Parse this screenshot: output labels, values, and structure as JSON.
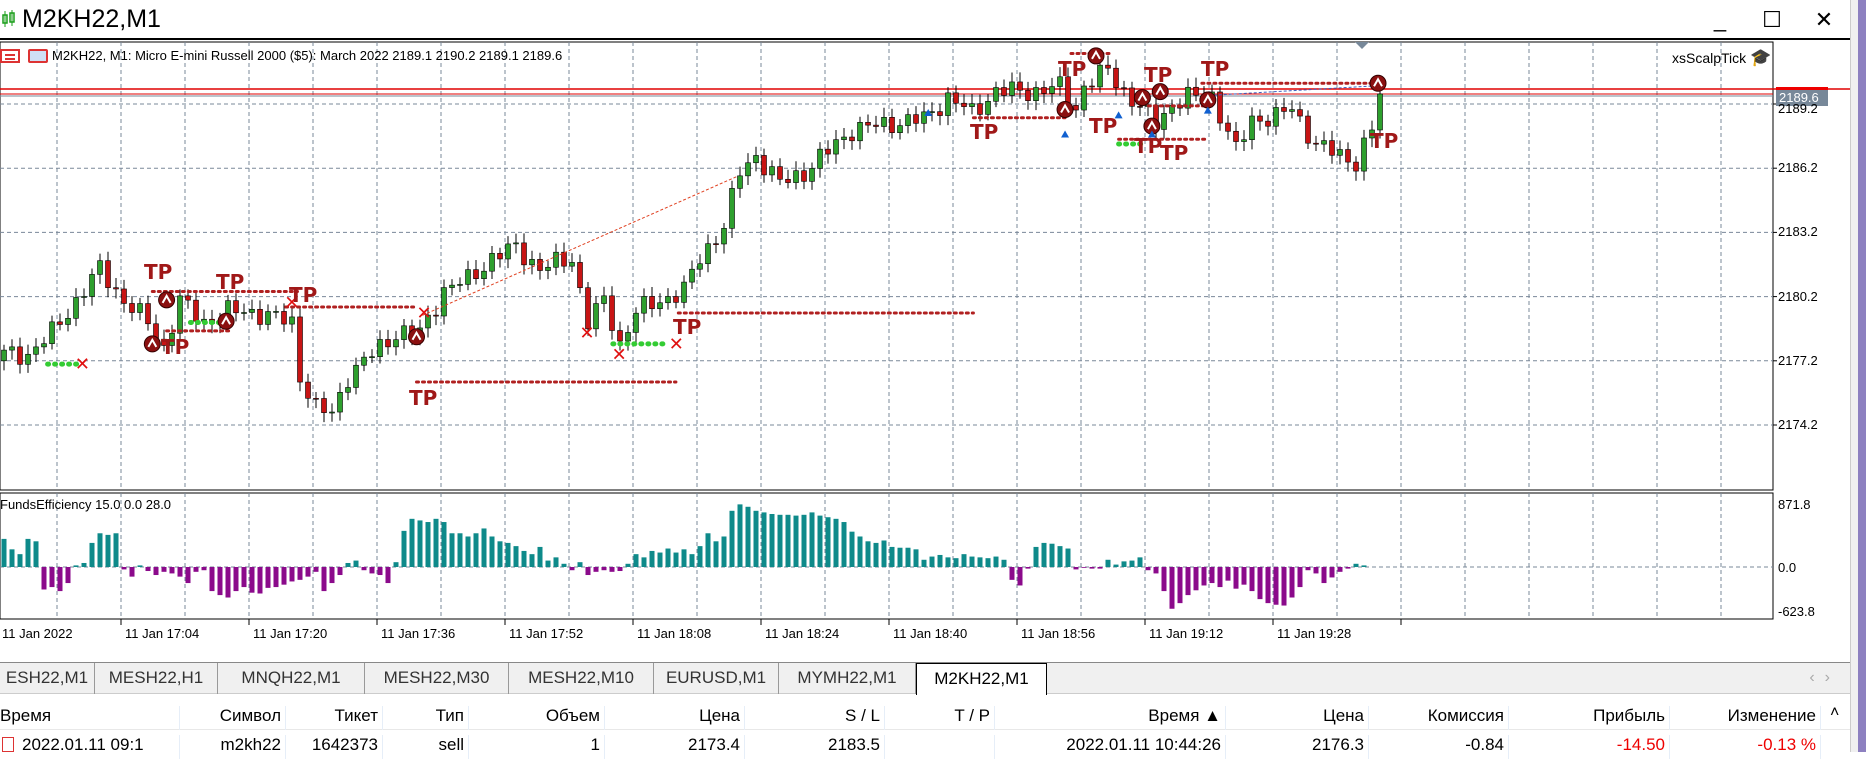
{
  "window": {
    "title": "M2KH22,M1",
    "minimize": "_",
    "maximize": "☐",
    "close": "✕"
  },
  "chart": {
    "info": "M2KH22, M1:  Micro E-mini Russell 2000 ($5): March 2022  2189.1 2190.2 2189.1 2189.6",
    "expert": "xsScalpTick",
    "current_price": "2189.6",
    "price_labels": [
      "2189.2",
      "2186.2",
      "2183.2",
      "2180.2",
      "2177.2",
      "2174.2"
    ],
    "time_labels": [
      "11 Jan 2022",
      "11 Jan 17:04",
      "11 Jan 17:20",
      "11 Jan 17:36",
      "11 Jan 17:52",
      "11 Jan 18:08",
      "11 Jan 18:24",
      "11 Jan 18:40",
      "11 Jan 18:56",
      "11 Jan 19:12",
      "11 Jan 19:28"
    ],
    "tp_label": "TP",
    "colors": {
      "bull": "#2ea02e",
      "bear": "#c81414",
      "indicator_pos": "#0e8a8a",
      "indicator_neg": "#8b0a8b",
      "price_line": "#e00000",
      "price_box": "#778899"
    }
  },
  "indicator": {
    "title": "FundsEfficiency 15.0 0.0 28.0",
    "max_label": "871.8",
    "zero_label": "0.0",
    "min_label": "-623.8"
  },
  "chart_data": {
    "type": "candlestick",
    "start_time": "16:49",
    "timeframe": "M1",
    "price_keypoints": [
      [
        "16:49",
        2177.5
      ],
      [
        "16:52",
        2177.5
      ],
      [
        "16:55",
        2178.5
      ],
      [
        "16:58",
        2180
      ],
      [
        "17:01",
        2181.5
      ],
      [
        "17:04",
        2180
      ],
      [
        "17:07",
        2179
      ],
      [
        "17:09",
        2177.8
      ],
      [
        "17:11",
        2180
      ],
      [
        "17:14",
        2179
      ],
      [
        "17:17",
        2179.5
      ],
      [
        "17:20",
        2179.5
      ],
      [
        "17:25",
        2179
      ],
      [
        "17:26",
        2176.5
      ],
      [
        "17:28",
        2175
      ],
      [
        "17:30",
        2174.7
      ],
      [
        "17:32",
        2176.5
      ],
      [
        "17:35",
        2177.5
      ],
      [
        "17:38",
        2178.5
      ],
      [
        "17:41",
        2178.5
      ],
      [
        "17:44",
        2180.5
      ],
      [
        "17:47",
        2181
      ],
      [
        "17:50",
        2182
      ],
      [
        "17:53",
        2182.5
      ],
      [
        "17:56",
        2181.5
      ],
      [
        "18:00",
        2182
      ],
      [
        "18:02",
        2179
      ],
      [
        "18:04",
        2180
      ],
      [
        "18:06",
        2178
      ],
      [
        "18:08",
        2179.5
      ],
      [
        "18:11",
        2180
      ],
      [
        "18:14",
        2180.5
      ],
      [
        "18:16",
        2182
      ],
      [
        "18:19",
        2183.5
      ],
      [
        "18:21",
        2186
      ],
      [
        "18:23",
        2186.8
      ],
      [
        "18:26",
        2185.5
      ],
      [
        "18:29",
        2186
      ],
      [
        "18:32",
        2187
      ],
      [
        "18:35",
        2188
      ],
      [
        "18:40",
        2188.3
      ],
      [
        "18:44",
        2188.5
      ],
      [
        "18:47",
        2189.5
      ],
      [
        "18:50",
        2188.8
      ],
      [
        "18:53",
        2189.8
      ],
      [
        "18:58",
        2189.8
      ],
      [
        "19:01",
        2190
      ],
      [
        "19:03",
        2189
      ],
      [
        "19:04",
        2190
      ],
      [
        "19:07",
        2190.8
      ],
      [
        "19:09",
        2189.8
      ],
      [
        "19:11",
        2189
      ],
      [
        "19:13",
        2188.3
      ],
      [
        "19:15",
        2189.2
      ],
      [
        "19:17",
        2189.5
      ],
      [
        "19:20",
        2189.6
      ],
      [
        "19:23",
        2187
      ],
      [
        "19:25",
        2188.5
      ],
      [
        "19:28",
        2188.6
      ],
      [
        "19:30",
        2189
      ],
      [
        "19:33",
        2187.3
      ],
      [
        "19:36",
        2186.8
      ],
      [
        "19:38",
        2186.5
      ],
      [
        "19:40",
        2188
      ],
      [
        "19:41",
        2189.6
      ]
    ],
    "ylim": [
      2173.0,
      2191.0
    ],
    "indicator_values": [
      350,
      220,
      160,
      350,
      320,
      -280,
      -250,
      -300,
      -200,
      20,
      50,
      300,
      420,
      400,
      420,
      -30,
      -120,
      20,
      -50,
      -100,
      -60,
      -80,
      -120,
      -200,
      -60,
      -40,
      -300,
      -350,
      -380,
      -300,
      -250,
      -320,
      -330,
      -260,
      -250,
      -220,
      -180,
      -160,
      -120,
      -60,
      -300,
      -200,
      -100,
      50,
      80,
      -40,
      -80,
      -100,
      -200,
      60,
      450,
      600,
      580,
      560,
      600,
      560,
      420,
      420,
      380,
      420,
      480,
      380,
      320,
      300,
      260,
      200,
      160,
      250,
      80,
      120,
      40,
      -40,
      60,
      -100,
      -60,
      -40,
      -60,
      -50,
      40,
      160,
      120,
      200,
      180,
      230,
      180,
      220,
      160,
      260,
      420,
      320,
      380,
      700,
      780,
      750,
      700,
      680,
      660,
      650,
      650,
      640,
      650,
      680,
      640,
      620,
      600,
      560,
      440,
      380,
      320,
      300,
      330,
      250,
      240,
      240,
      220,
      90,
      130,
      150,
      120,
      110,
      160,
      130,
      120,
      110,
      130,
      90,
      -160,
      -230,
      -20,
      250,
      300,
      290,
      260,
      230,
      -30,
      -10,
      -20,
      -20,
      90,
      30,
      70,
      80,
      120,
      -40,
      -80,
      -300,
      -520,
      -450,
      -350,
      -290,
      -230,
      -200,
      -250,
      -170,
      -270,
      -220,
      -300,
      -400,
      -450,
      -470,
      -480,
      -380,
      -250,
      -40,
      -80,
      -200,
      -130,
      -60,
      -20,
      40,
      20,
      0,
      0
    ],
    "indicator_ylim": [
      -623.8,
      871.8
    ]
  },
  "tabs": [
    "ESH22,M1",
    "MESH22,H1",
    "MNQH22,M1",
    "MESH22,M30",
    "MESH22,M10",
    "EURUSD,M1",
    "MYMH22,M1",
    "M2KH22,M1"
  ],
  "table": {
    "headers": [
      "Время",
      "Символ",
      "Тикет",
      "Тип",
      "Объем",
      "Цена",
      "S / L",
      "T / P",
      "Время ▲",
      "Цена",
      "Комиссия",
      "Прибыль",
      "Изменение"
    ],
    "rows": [
      [
        "2022.01.11 09:1",
        "m2kh22",
        "1642373",
        "sell",
        "1",
        "2173.4",
        "2183.5",
        "",
        "2022.01.11 10:44:26",
        "2176.3",
        "-0.84",
        "-14.50",
        "-0.13 %"
      ]
    ]
  }
}
